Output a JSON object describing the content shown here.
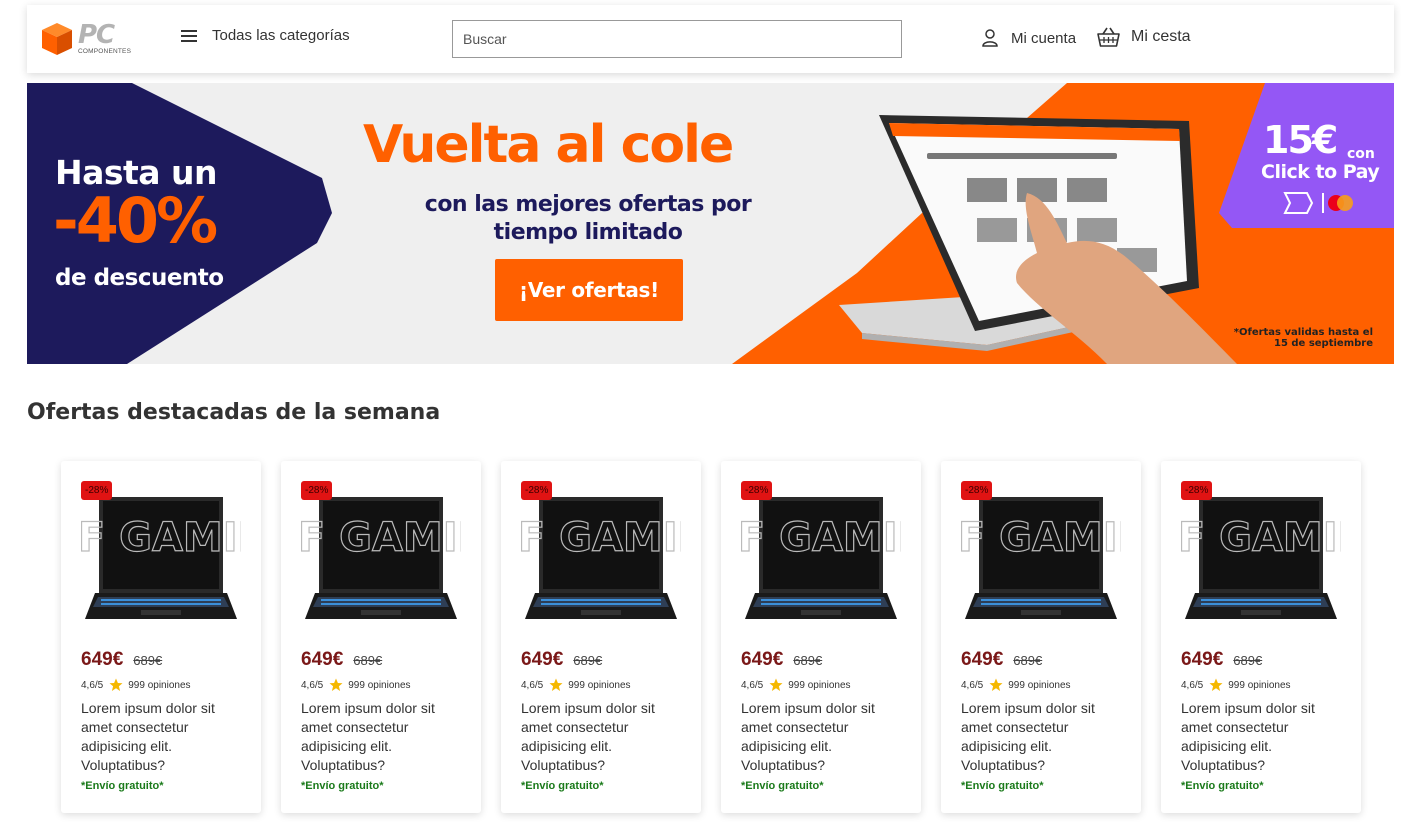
{
  "header": {
    "logo_main": "PC",
    "logo_sub": "COMPONENTES",
    "categories_label": "Todas las categorías",
    "search_placeholder": "Buscar",
    "account_label": "Mi cuenta",
    "cart_label": "Mi cesta"
  },
  "banner": {
    "line1": "Hasta un",
    "discount": "-40%",
    "line3": "de descuento",
    "title": "Vuelta al cole",
    "subtitle": "con las mejores ofertas por tiempo limitado",
    "cta": "¡Ver ofertas!",
    "promo_amount": "15€",
    "promo_con": "con",
    "promo_method": "Click to Pay",
    "note": "*Ofertas validas hasta el 15 de septiembre",
    "colors": {
      "navy": "#1d1a5c",
      "orange": "#ff6000",
      "purple": "#9457f5"
    }
  },
  "section": {
    "title": "Ofertas destacadas de la semana"
  },
  "products": [
    {
      "badge": "-28%",
      "price": "649€",
      "old_price": "689€",
      "rating": "4,6/5",
      "reviews": "999 opiniones",
      "description": "Lorem ipsum dolor sit amet consectetur adipisicing elit. Voluptatibus?",
      "shipping": "*Envío gratuito*"
    },
    {
      "badge": "-28%",
      "price": "649€",
      "old_price": "689€",
      "rating": "4,6/5",
      "reviews": "999 opiniones",
      "description": "Lorem ipsum dolor sit amet consectetur adipisicing elit. Voluptatibus?",
      "shipping": "*Envío gratuito*"
    },
    {
      "badge": "-28%",
      "price": "649€",
      "old_price": "689€",
      "rating": "4,6/5",
      "reviews": "999 opiniones",
      "description": "Lorem ipsum dolor sit amet consectetur adipisicing elit. Voluptatibus?",
      "shipping": "*Envío gratuito*"
    },
    {
      "badge": "-28%",
      "price": "649€",
      "old_price": "689€",
      "rating": "4,6/5",
      "reviews": "999 opiniones",
      "description": "Lorem ipsum dolor sit amet consectetur adipisicing elit. Voluptatibus?",
      "shipping": "*Envío gratuito*"
    },
    {
      "badge": "-28%",
      "price": "649€",
      "old_price": "689€",
      "rating": "4,6/5",
      "reviews": "999 opiniones",
      "description": "Lorem ipsum dolor sit amet consectetur adipisicing elit. Voluptatibus?",
      "shipping": "*Envío gratuito*"
    },
    {
      "badge": "-28%",
      "price": "649€",
      "old_price": "689€",
      "rating": "4,6/5",
      "reviews": "999 opiniones",
      "description": "Lorem ipsum dolor sit amet consectetur adipisicing elit. Voluptatibus?",
      "shipping": "*Envío gratuito*"
    }
  ],
  "product_image_text": "TUF GAMING"
}
